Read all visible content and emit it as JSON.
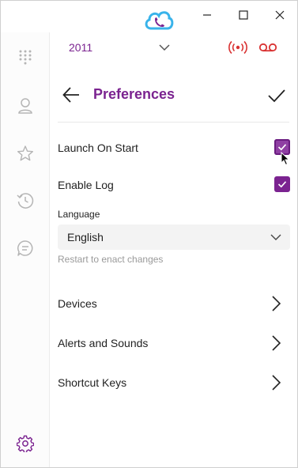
{
  "window": {
    "minimize_icon": "minimize-icon",
    "maximize_icon": "maximize-icon",
    "close_icon": "close-icon",
    "logo_icon": "cloud-phone-logo-icon"
  },
  "sidebar": {
    "items": [
      {
        "name": "dialpad",
        "icon": "dialpad-icon"
      },
      {
        "name": "contacts",
        "icon": "person-icon"
      },
      {
        "name": "favorites",
        "icon": "star-icon"
      },
      {
        "name": "history",
        "icon": "history-icon"
      },
      {
        "name": "messages",
        "icon": "chat-icon"
      },
      {
        "name": "settings",
        "icon": "gear-icon"
      }
    ]
  },
  "extension": {
    "number": "2011",
    "status_icons": [
      "live-broadcast-icon",
      "voicemail-icon"
    ]
  },
  "header": {
    "title": "Preferences",
    "back_icon": "arrow-left-icon",
    "confirm_icon": "checkmark-icon"
  },
  "options": {
    "launch_on_start": {
      "label": "Launch On Start",
      "checked": true
    },
    "enable_log": {
      "label": "Enable Log",
      "checked": true
    }
  },
  "language": {
    "label": "Language",
    "selected": "English",
    "hint": "Restart to enact changes"
  },
  "nav_items": [
    {
      "label": "Devices"
    },
    {
      "label": "Alerts and Sounds"
    },
    {
      "label": "Shortcut Keys"
    }
  ],
  "colors": {
    "accent": "#7b2390",
    "status_red": "#d93232",
    "logo_blue": "#39b3ea"
  }
}
